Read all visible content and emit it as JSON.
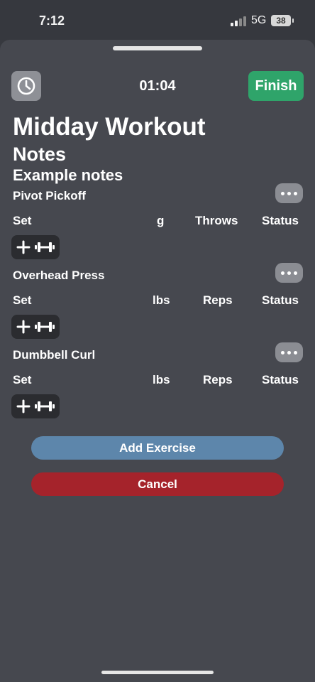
{
  "status_bar": {
    "time": "7:12",
    "network": "5G",
    "battery": "38"
  },
  "header": {
    "timer": "01:04",
    "finish_label": "Finish",
    "clock_icon": "clock-icon"
  },
  "workout": {
    "title": "Midday Workout",
    "notes_heading": "Notes",
    "notes_text": "Example notes"
  },
  "exercises": [
    {
      "name": "Pivot Pickoff",
      "columns": {
        "set": "Set",
        "unit": "g",
        "metric": "Throws",
        "status": "Status"
      }
    },
    {
      "name": "Overhead Press",
      "columns": {
        "set": "Set",
        "unit": "lbs",
        "metric": "Reps",
        "status": "Status"
      }
    },
    {
      "name": "Dumbbell Curl",
      "columns": {
        "set": "Set",
        "unit": "lbs",
        "metric": "Reps",
        "status": "Status"
      }
    }
  ],
  "actions": {
    "add_exercise": "Add Exercise",
    "cancel": "Cancel"
  },
  "colors": {
    "finish": "#2fa46a",
    "add_exercise": "#5d86ab",
    "cancel": "#a5232b"
  }
}
